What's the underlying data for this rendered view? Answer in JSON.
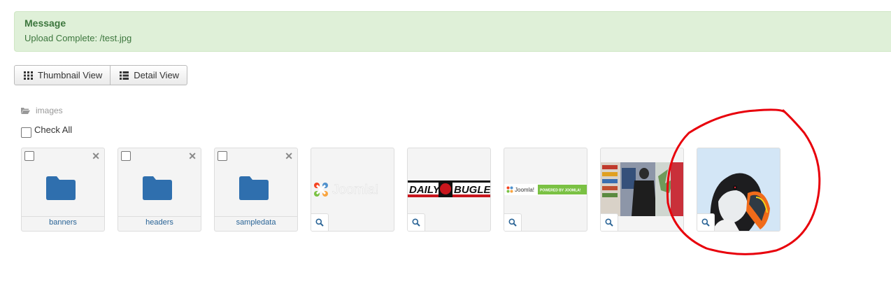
{
  "message": {
    "heading": "Message",
    "text": "Upload Complete: /test.jpg"
  },
  "view_toggle": {
    "thumbnail_label": "Thumbnail View",
    "detail_label": "Detail View"
  },
  "breadcrumb": {
    "folder": "images"
  },
  "check_all_label": "Check All",
  "folders": [
    {
      "name": "banners"
    },
    {
      "name": "headers"
    },
    {
      "name": "sampledata"
    }
  ],
  "images": [
    {
      "name": "joomla_black",
      "logo_text": "Joomla!"
    },
    {
      "name": "daily_bugle",
      "logo_text_left": "DAILY",
      "logo_text_right": "BUGLE"
    },
    {
      "name": "powered_by",
      "logo_text": "Joomla!",
      "badge_text": "POWERED BY JOOMLA!"
    },
    {
      "name": "photo_store"
    },
    {
      "name": "puffin"
    }
  ],
  "colors": {
    "alert_bg": "#dff0d8",
    "alert_text": "#3c763d",
    "folder_blue": "#2f6fae",
    "link_blue": "#2a6496",
    "annotation_red": "#e8000b"
  },
  "icons": {
    "thumbnail": "grid-icon",
    "detail": "list-icon",
    "breadcrumb": "folder-open-icon",
    "zoom": "magnifier-icon",
    "delete": "close-icon"
  }
}
